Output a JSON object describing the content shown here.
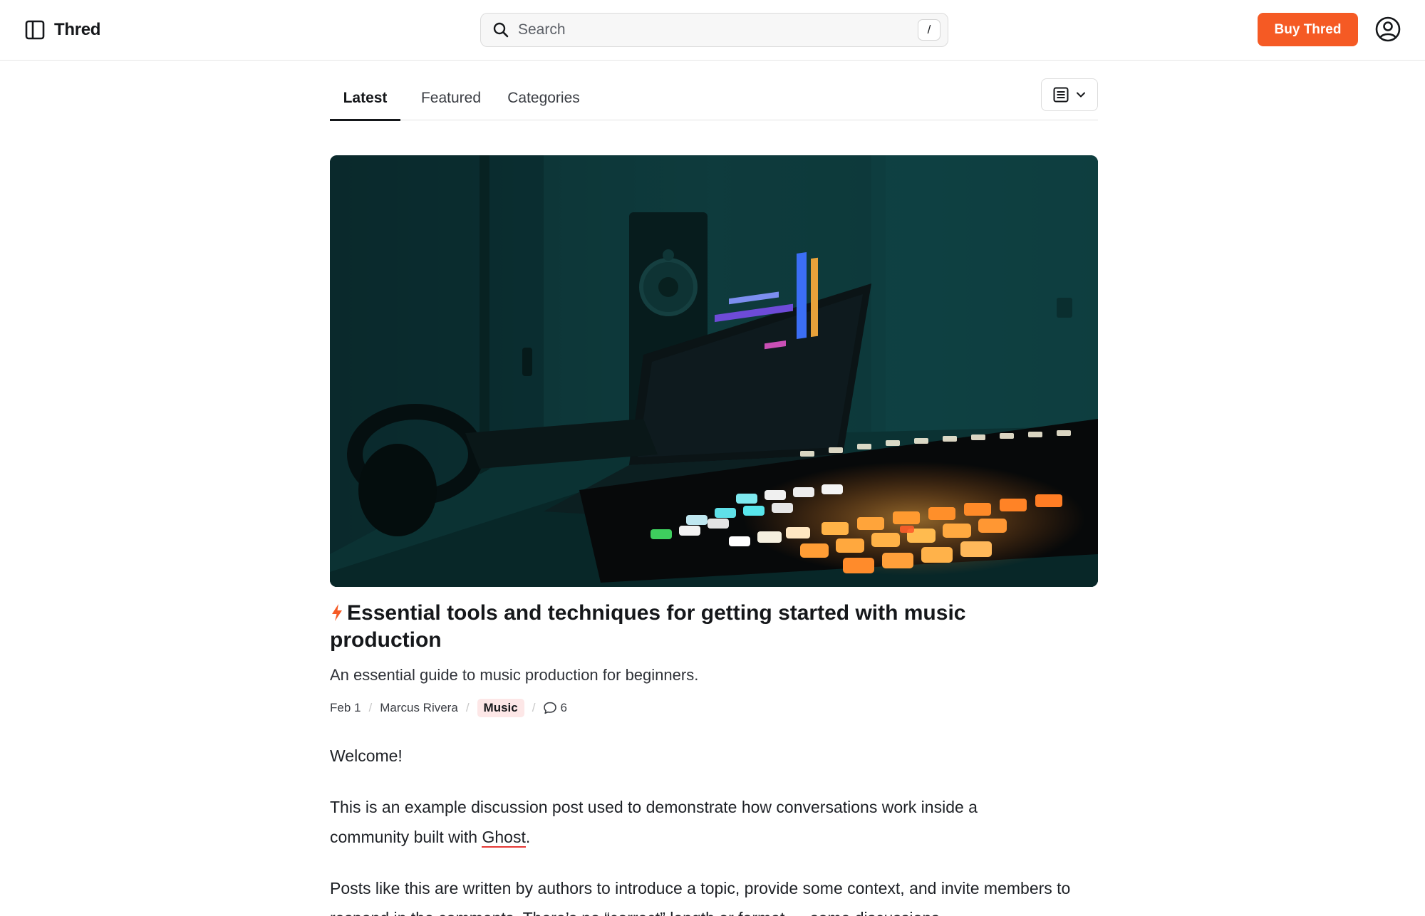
{
  "header": {
    "brand_name": "Thred",
    "search_placeholder": "Search",
    "search_shortcut": "/",
    "buy_label": "Buy Thred",
    "accent_color": "#f55a24"
  },
  "tabs": [
    {
      "label": "Latest",
      "active": true
    },
    {
      "label": "Featured",
      "active": false
    },
    {
      "label": "Categories",
      "active": false
    }
  ],
  "view_toggle": {
    "icon": "list-view-icon"
  },
  "post": {
    "title": "Essential tools and techniques for getting started with music production",
    "excerpt": "An essential guide to music production for beginners.",
    "meta": {
      "date": "Feb 1",
      "author": "Marcus Rivera",
      "tag": "Music",
      "comment_count": "6"
    },
    "body": {
      "p1": "Welcome!",
      "p2_before": "This is an example discussion post used to demonstrate how conversations work inside a community built with ",
      "p2_link": "Ghost",
      "p2_after": ".",
      "p3": "Posts like this are written by authors to introduce a topic, provide some context, and invite members to respond in the comments. There’s no “correct” length or format — some discussions"
    }
  }
}
